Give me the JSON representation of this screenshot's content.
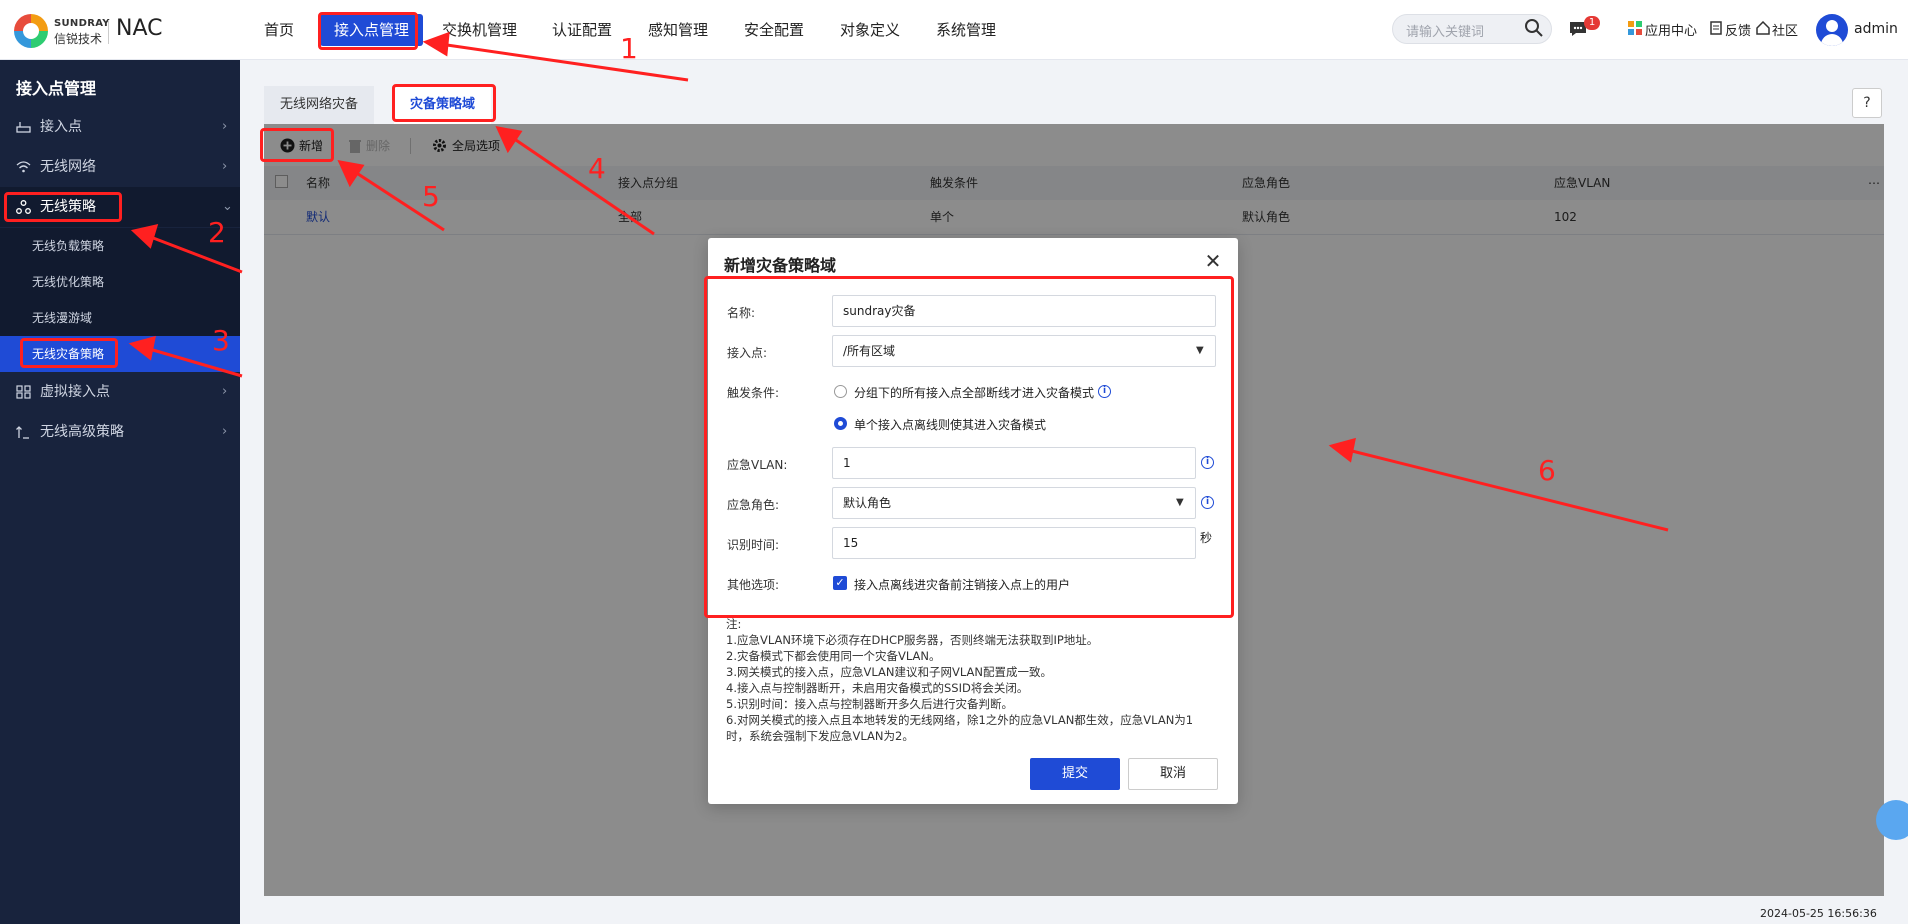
{
  "brand": {
    "logo_en": "SUNDRAY",
    "logo_cn": "信锐技术",
    "product": "NAC"
  },
  "topnav": {
    "items": [
      "首页",
      "接入点管理",
      "交换机管理",
      "认证配置",
      "感知管理",
      "安全配置",
      "对象定义",
      "系统管理"
    ],
    "active": "接入点管理"
  },
  "topright": {
    "search_placeholder": "请输入关键词",
    "message_badge": "1",
    "app_center": "应用中心",
    "feedback": "反馈",
    "community": "社区",
    "user": "admin"
  },
  "sidebar": {
    "title": "接入点管理",
    "items": [
      {
        "label": "接入点",
        "icon": "router-icon"
      },
      {
        "label": "无线网络",
        "icon": "wifi-icon"
      },
      {
        "label": "无线策略",
        "icon": "policy-icon",
        "expanded": true
      },
      {
        "label": "虚拟接入点",
        "icon": "virtual-ap-icon"
      },
      {
        "label": "无线高级策略",
        "icon": "advanced-icon"
      }
    ],
    "sub_items": [
      "无线负载策略",
      "无线优化策略",
      "无线漫游域",
      "无线灾备策略"
    ],
    "active_sub": "无线灾备策略"
  },
  "tabs": [
    "无线网络灾备",
    "灾备策略域"
  ],
  "active_tab": "灾备策略域",
  "toolbar": {
    "add": "新增",
    "delete": "删除",
    "global": "全局选项"
  },
  "table": {
    "columns": [
      "名称",
      "接入点分组",
      "触发条件",
      "应急角色",
      "应急VLAN"
    ],
    "rows": [
      [
        "默认",
        "全部",
        "单个",
        "默认角色",
        "102"
      ]
    ]
  },
  "modal": {
    "title": "新增灾备策略域",
    "fields": {
      "name_label": "名称:",
      "name_value": "sundray灾备",
      "ap_label": "接入点:",
      "ap_value": "/所有区域",
      "trigger_label": "触发条件:",
      "trigger_opt1": "分组下的所有接入点全部断线才进入灾备模式",
      "trigger_opt2": "单个接入点离线则使其进入灾备模式",
      "trigger_selected": 2,
      "vlan_label": "应急VLAN:",
      "vlan_value": "1",
      "role_label": "应急角色:",
      "role_value": "默认角色",
      "time_label": "识别时间:",
      "time_value": "15",
      "time_unit": "秒",
      "other_label": "其他选项:",
      "other_opt": "接入点离线进灾备前注销接入点上的用户",
      "other_checked": true
    },
    "notes": [
      "注:",
      "1.应急VLAN环境下必须存在DHCP服务器，否则终端无法获取到IP地址。",
      "2.灾备模式下都会使用同一个灾备VLAN。",
      "3.网关模式的接入点，应急VLAN建议和子网VLAN配置成一致。",
      "4.接入点与控制器断开，未启用灾备模式的SSID将会关闭。",
      "5.识别时间：接入点与控制器断开多久后进行灾备判断。",
      "6.对网关模式的接入点且本地转发的无线网络，除1之外的应急VLAN都生效，应急VLAN为1",
      "时，系统会强制下发应急VLAN为2。"
    ],
    "submit": "提交",
    "cancel": "取消"
  },
  "footer": {
    "datetime": "2024-05-25 16:56:36"
  },
  "annotations": [
    "1",
    "2",
    "3",
    "4",
    "5",
    "6"
  ],
  "colors": {
    "accent": "#1f4bd6",
    "sidebar": "#18233d",
    "annotation": "#ff2020"
  }
}
